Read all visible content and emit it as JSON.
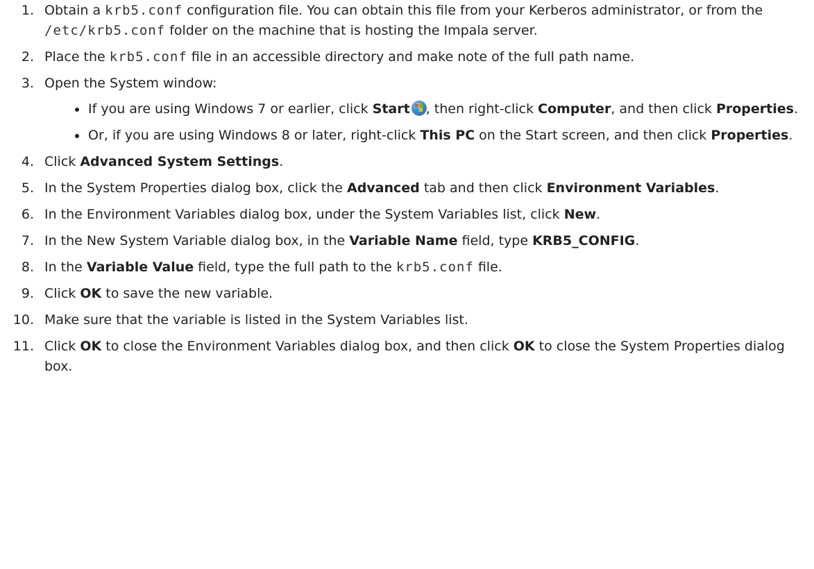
{
  "steps": [
    {
      "number": "1.",
      "parts": {
        "t1": "Obtain a ",
        "c1": "krb5.conf",
        "t2": " configuration file. You can obtain this file from your Kerberos administrator, or from the ",
        "c2": "/etc/krb5.conf",
        "t3": " folder on the machine that is hosting the Impala server."
      }
    },
    {
      "number": "2.",
      "parts": {
        "t1": "Place the ",
        "c1": "krb5.conf",
        "t2": " file in an accessible directory and make note of the full path name."
      }
    },
    {
      "number": "3.",
      "parts": {
        "t1": "Open the System window:"
      },
      "sub": [
        {
          "t1": "If you are using Windows 7 or earlier, click ",
          "b1": "Start",
          "t2": ", then right-click ",
          "b2": "Computer",
          "t3": ", and then click ",
          "b3": "Properties",
          "t4": "."
        },
        {
          "t1": "Or, if you are using Windows 8 or later, right-click ",
          "b1": "This PC",
          "t2": " on the Start screen, and then click ",
          "b2": "Properties",
          "t3": "."
        }
      ]
    },
    {
      "number": "4.",
      "parts": {
        "t1": "Click ",
        "b1": "Advanced System Settings",
        "t2": "."
      }
    },
    {
      "number": "5.",
      "parts": {
        "t1": "In the System Properties dialog box, click the ",
        "b1": "Advanced",
        "t2": " tab and then click ",
        "b2": "Environment Variables",
        "t3": "."
      }
    },
    {
      "number": "6.",
      "parts": {
        "t1": "In the Environment Variables dialog box, under the System Variables list, click ",
        "b1": "New",
        "t2": "."
      }
    },
    {
      "number": "7.",
      "parts": {
        "t1": "In the New System Variable dialog box, in the ",
        "b1": "Variable Name",
        "t2": " field, type ",
        "b2": "KRB5_CONFIG",
        "t3": "."
      }
    },
    {
      "number": "8.",
      "parts": {
        "t1": "In the ",
        "b1": "Variable Value",
        "t2": " field, type the full path to the ",
        "c1": "krb5.conf",
        "t3": " file."
      }
    },
    {
      "number": "9.",
      "parts": {
        "t1": "Click ",
        "b1": "OK",
        "t2": " to save the new variable."
      }
    },
    {
      "number": "10.",
      "parts": {
        "t1": "Make sure that the variable is listed in the System Variables list."
      }
    },
    {
      "number": "11.",
      "parts": {
        "t1": "Click ",
        "b1": "OK",
        "t2": " to close the Environment Variables dialog box, and then click ",
        "b2": "OK",
        "t3": " to close the System Properties dialog box."
      }
    }
  ],
  "icons": {
    "start": "windows-start-orb-icon"
  },
  "colors": {
    "text": "#222222",
    "background": "#ffffff"
  }
}
